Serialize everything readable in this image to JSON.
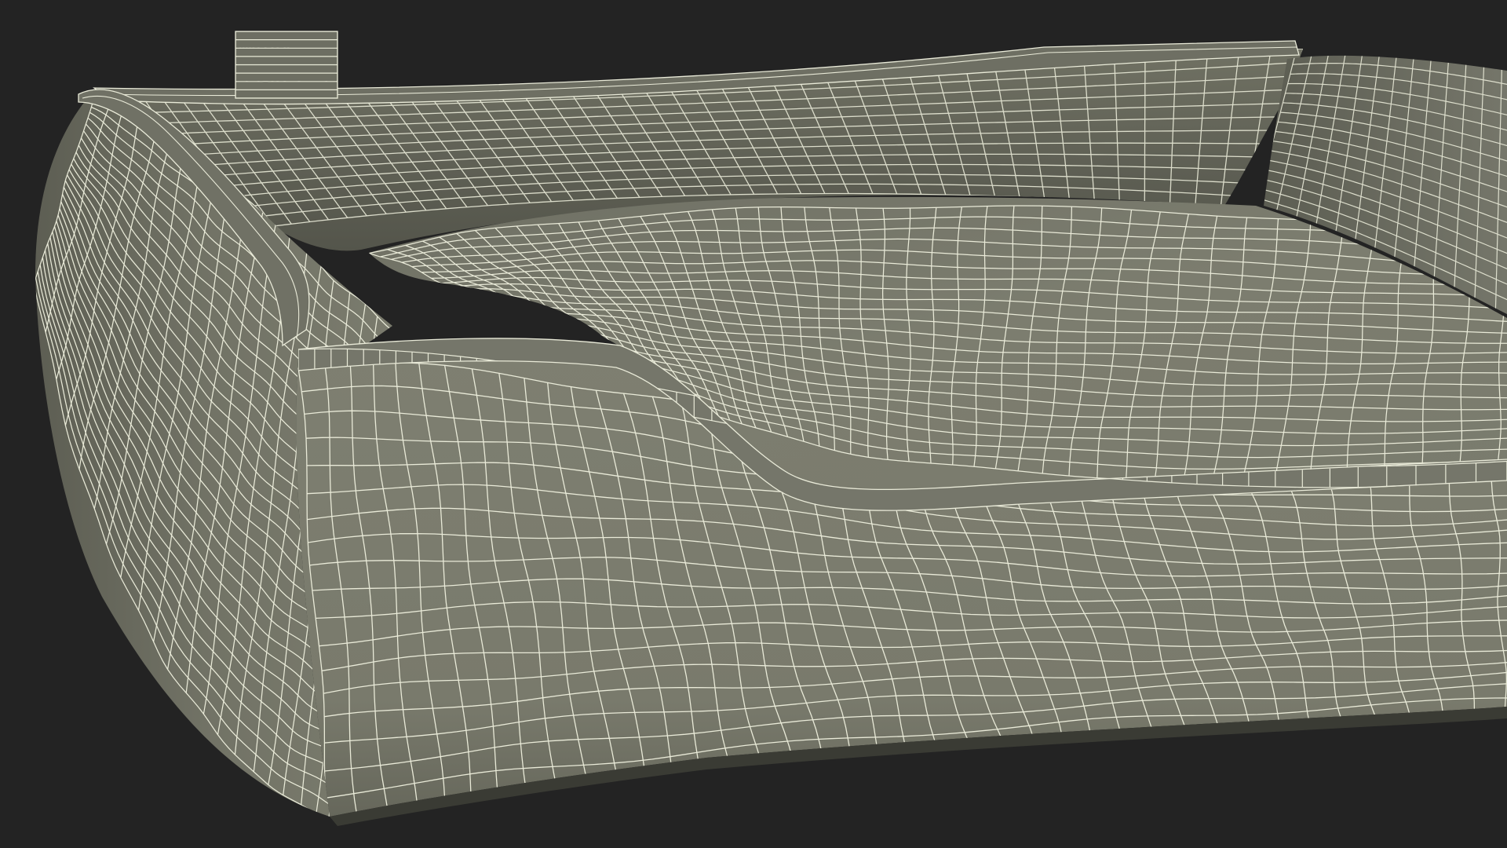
{
  "render": {
    "background_color": "#232323",
    "mesh_fill_color": "#7b7c6e",
    "mesh_shade_color": "#5f6055",
    "mesh_dark_color": "#4d4e45",
    "wire_color": "#e9ead8"
  },
  "subject": {
    "kind": "wireframe-3d-model",
    "wireframe_visible": true
  }
}
